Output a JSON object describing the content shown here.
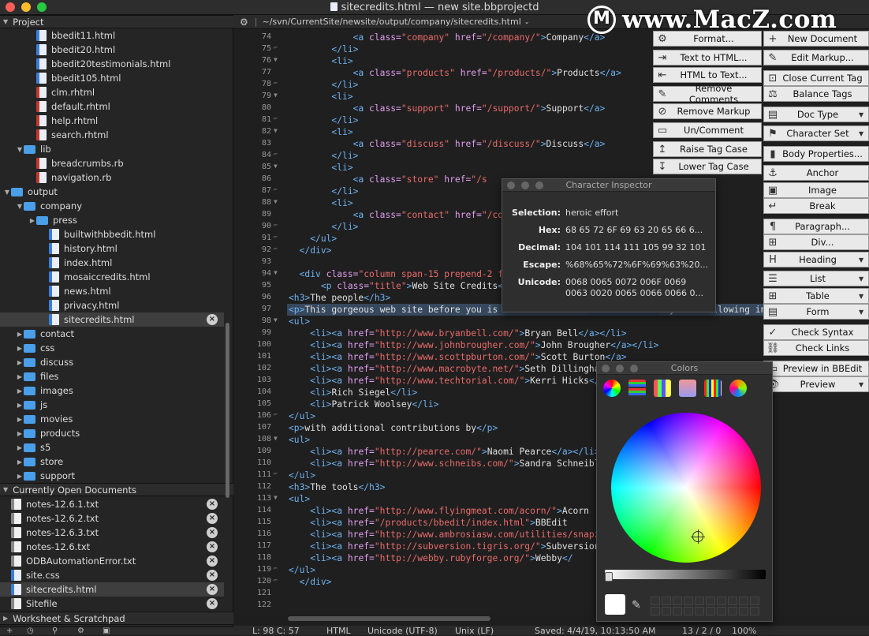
{
  "window": {
    "title": "sitecredits.html — new site.bbprojectd"
  },
  "watermark": {
    "text": "www.MacZ.com"
  },
  "sidebar": {
    "project_header": "Project",
    "tree": [
      {
        "label": "bbedit11.html",
        "type": "html",
        "indent": 2
      },
      {
        "label": "bbedit20.html",
        "type": "html",
        "indent": 2
      },
      {
        "label": "bbedit20testimonials.html",
        "type": "html",
        "indent": 2
      },
      {
        "label": "bbedit105.html",
        "type": "html",
        "indent": 2
      },
      {
        "label": "clm.rhtml",
        "type": "rhtml",
        "indent": 2
      },
      {
        "label": "default.rhtml",
        "type": "rhtml",
        "indent": 2
      },
      {
        "label": "help.rhtml",
        "type": "rhtml",
        "indent": 2
      },
      {
        "label": "search.rhtml",
        "type": "rhtml",
        "indent": 2
      },
      {
        "label": "lib",
        "type": "folder",
        "indent": 1,
        "disc": "▼"
      },
      {
        "label": "breadcrumbs.rb",
        "type": "rb",
        "indent": 2
      },
      {
        "label": "navigation.rb",
        "type": "rb",
        "indent": 2
      },
      {
        "label": "output",
        "type": "folder",
        "indent": 0,
        "disc": "▼"
      },
      {
        "label": "company",
        "type": "folder",
        "indent": 1,
        "disc": "▼"
      },
      {
        "label": "press",
        "type": "folder",
        "indent": 2,
        "disc": "▶"
      },
      {
        "label": "builtwithbbedit.html",
        "type": "html",
        "indent": 3
      },
      {
        "label": "history.html",
        "type": "html",
        "indent": 3
      },
      {
        "label": "index.html",
        "type": "html",
        "indent": 3
      },
      {
        "label": "mosaiccredits.html",
        "type": "html",
        "indent": 3
      },
      {
        "label": "news.html",
        "type": "html",
        "indent": 3
      },
      {
        "label": "privacy.html",
        "type": "html",
        "indent": 3
      },
      {
        "label": "sitecredits.html",
        "type": "html",
        "indent": 3,
        "selected": true,
        "close": true
      },
      {
        "label": "contact",
        "type": "folder",
        "indent": 1,
        "disc": "▶"
      },
      {
        "label": "css",
        "type": "folder",
        "indent": 1,
        "disc": "▶"
      },
      {
        "label": "discuss",
        "type": "folder",
        "indent": 1,
        "disc": "▶"
      },
      {
        "label": "files",
        "type": "folder",
        "indent": 1,
        "disc": "▶"
      },
      {
        "label": "images",
        "type": "folder",
        "indent": 1,
        "disc": "▶"
      },
      {
        "label": "js",
        "type": "folder",
        "indent": 1,
        "disc": "▶"
      },
      {
        "label": "movies",
        "type": "folder",
        "indent": 1,
        "disc": "▶"
      },
      {
        "label": "products",
        "type": "folder",
        "indent": 1,
        "disc": "▶"
      },
      {
        "label": "s5",
        "type": "folder",
        "indent": 1,
        "disc": "▶"
      },
      {
        "label": "store",
        "type": "folder",
        "indent": 1,
        "disc": "▶"
      },
      {
        "label": "support",
        "type": "folder",
        "indent": 1,
        "disc": "▶"
      }
    ],
    "open_docs_header": "Currently Open Documents",
    "open_docs": [
      {
        "label": "notes-12.6.1.txt",
        "type": "txt"
      },
      {
        "label": "notes-12.6.2.txt",
        "type": "txt"
      },
      {
        "label": "notes-12.6.3.txt",
        "type": "txt"
      },
      {
        "label": "notes-12.6.txt",
        "type": "txt"
      },
      {
        "label": "ODBAutomationError.txt",
        "type": "txt"
      },
      {
        "label": "site.css",
        "type": "css"
      },
      {
        "label": "sitecredits.html",
        "type": "html",
        "selected": true
      },
      {
        "label": "Sitefile",
        "type": "txt"
      }
    ],
    "worksheet_header": "Worksheet & Scratchpad"
  },
  "navbar": {
    "path": "~/svn/CurrentSite/newsite/output/company/sitecredits.html"
  },
  "editor": {
    "lines": [
      {
        "n": "74",
        "f": "",
        "h": "            <t>&lt;a</t> <a>class=</a><v>\"company\"</v> <a>href=</a><v>\"/company/\"</v><t>&gt;</t>Company<t>&lt;/a&gt;</t>"
      },
      {
        "n": "75",
        "f": "⌐",
        "h": "        <t>&lt;/li&gt;</t>"
      },
      {
        "n": "76",
        "f": "▼",
        "h": "        <t>&lt;li&gt;</t>"
      },
      {
        "n": "77",
        "f": "",
        "h": "            <t>&lt;a</t> <a>class=</a><v>\"products\"</v> <a>href=</a><v>\"/products/\"</v><t>&gt;</t>Products<t>&lt;/a&gt;</t>"
      },
      {
        "n": "78",
        "f": "⌐",
        "h": "        <t>&lt;/li&gt;</t>"
      },
      {
        "n": "79",
        "f": "▼",
        "h": "        <t>&lt;li&gt;</t>"
      },
      {
        "n": "80",
        "f": "",
        "h": "            <t>&lt;a</t> <a>class=</a><v>\"support\"</v> <a>href=</a><v>\"/support/\"</v><t>&gt;</t>Support<t>&lt;/a&gt;</t>"
      },
      {
        "n": "81",
        "f": "⌐",
        "h": "        <t>&lt;/li&gt;</t>"
      },
      {
        "n": "82",
        "f": "▼",
        "h": "        <t>&lt;li&gt;</t>"
      },
      {
        "n": "83",
        "f": "",
        "h": "            <t>&lt;a</t> <a>class=</a><v>\"discuss\"</v> <a>href=</a><v>\"/discuss/\"</v><t>&gt;</t>Discuss<t>&lt;/a&gt;</t>"
      },
      {
        "n": "84",
        "f": "⌐",
        "h": "        <t>&lt;/li&gt;</t>"
      },
      {
        "n": "85",
        "f": "▼",
        "h": "        <t>&lt;li&gt;</t>"
      },
      {
        "n": "86",
        "f": "",
        "h": "            <t>&lt;a</t> <a>class=</a><v>\"store\"</v> <a>href=</a><v>\"/s</v>"
      },
      {
        "n": "87",
        "f": "⌐",
        "h": "        <t>&lt;/li&gt;</t>"
      },
      {
        "n": "88",
        "f": "▼",
        "h": "        <t>&lt;li&gt;</t>"
      },
      {
        "n": "89",
        "f": "",
        "h": "            <t>&lt;a</t> <a>class=</a><v>\"contact\"</v> <a>href=</a><v>\"/contact/\"</v><t>&gt;</t>Contact<t>&lt;/a&gt;</t>"
      },
      {
        "n": "90",
        "f": "⌐",
        "h": "        <t>&lt;/li&gt;</t>"
      },
      {
        "n": "91",
        "f": "⌐",
        "h": "    <t>&lt;/ul&gt;</t>"
      },
      {
        "n": "92",
        "f": "⌐",
        "h": "  <t>&lt;/div&gt;</t>"
      },
      {
        "n": "93",
        "f": "",
        "h": ""
      },
      {
        "n": "94",
        "f": "▼",
        "h": "  <t>&lt;div</t> <a>class=</a><v>\"column span-15 prepend-2 f</v>"
      },
      {
        "n": "95",
        "f": "",
        "h": "      <t>&lt;p</t> <a>class=</a><v>\"title\"</v><t>&gt;</t>Web Site Credits<t>&lt;/</t>"
      },
      {
        "n": "96",
        "f": "",
        "h": "<t>&lt;h3&gt;</t>The people<t>&lt;/h3&gt;</t>"
      },
      {
        "n": "97",
        "f": "",
        "h": "<t>&lt;p&gt;</t>This gorgeous web site before you is the result of a <span class=\"hl\">heroic effort</span> by the following indiv",
        "sel": true
      },
      {
        "n": "98",
        "f": "▼",
        "h": "<t>&lt;ul&gt;</t>"
      },
      {
        "n": "99",
        "f": "",
        "h": "    <t>&lt;li&gt;&lt;a</t> <a>href=</a><v>\"http://www.bryanbell.com/\"</v><t>&gt;</t>Bryan Bell<t>&lt;/a&gt;&lt;/li&gt;</t>"
      },
      {
        "n": "100",
        "f": "",
        "h": "    <t>&lt;li&gt;&lt;a</t> <a>href=</a><v>\"http://www.johnbrougher.com/\"</v><t>&gt;</t>John Brougher<t>&lt;/a&gt;&lt;/li&gt;</t>"
      },
      {
        "n": "101",
        "f": "",
        "h": "    <t>&lt;li&gt;&lt;a</t> <a>href=</a><v>\"http://www.scottpburton.com/\"</v><t>&gt;</t>Scott Burton<t>&lt;/a&gt;</t>"
      },
      {
        "n": "102",
        "f": "",
        "h": "    <t>&lt;li&gt;&lt;a</t> <a>href=</a><v>\"http://www.macrobyte.net/\"</v><t>&gt;</t>Seth Dillingham"
      },
      {
        "n": "103",
        "f": "",
        "h": "    <t>&lt;li&gt;&lt;a</t> <a>href=</a><v>\"http://www.techtorial.com/\"</v><t>&gt;</t>Kerri Hicks<t>&lt;/a&gt;</t>"
      },
      {
        "n": "104",
        "f": "",
        "h": "    <t>&lt;li&gt;</t>Rich Siegel<t>&lt;/li&gt;</t>"
      },
      {
        "n": "105",
        "f": "",
        "h": "    <t>&lt;li&gt;</t>Patrick Woolsey<t>&lt;/li&gt;</t>"
      },
      {
        "n": "106",
        "f": "⌐",
        "h": "<t>&lt;/ul&gt;</t>"
      },
      {
        "n": "107",
        "f": "",
        "h": "<t>&lt;p&gt;</t>with additional contributions by<t>&lt;/p&gt;</t>"
      },
      {
        "n": "108",
        "f": "▼",
        "h": "<t>&lt;ul&gt;</t>"
      },
      {
        "n": "109",
        "f": "",
        "h": "    <t>&lt;li&gt;&lt;a</t> <a>href=</a><v>\"http://pearce.com/\"</v><t>&gt;</t>Naomi Pearce<t>&lt;/a&gt;&lt;/li&gt;</t>"
      },
      {
        "n": "110",
        "f": "",
        "h": "    <t>&lt;li&gt;&lt;a</t> <a>href=</a><v>\"http://www.schneibs.com/\"</v><t>&gt;</t>Sandra Schneible"
      },
      {
        "n": "111",
        "f": "⌐",
        "h": "<t>&lt;/ul&gt;</t>"
      },
      {
        "n": "112",
        "f": "",
        "h": "<t>&lt;h3&gt;</t>The tools<t>&lt;/h3&gt;</t>"
      },
      {
        "n": "113",
        "f": "▼",
        "h": "<t>&lt;ul&gt;</t>"
      },
      {
        "n": "114",
        "f": "",
        "h": "    <t>&lt;li&gt;&lt;a</t> <a>href=</a><v>\"http://www.flyingmeat.com/acorn/\"</v><t>&gt;</t>Acorn"
      },
      {
        "n": "115",
        "f": "",
        "h": "    <t>&lt;li&gt;&lt;a</t> <a>href=</a><v>\"/products/bbedit/index.html\"</v><t>&gt;</t>BBEdit"
      },
      {
        "n": "116",
        "f": "",
        "h": "    <t>&lt;li&gt;&lt;a</t> <a>href=</a><v>\"http://www.ambrosiasw.com/utilities/snapzpr</v>"
      },
      {
        "n": "117",
        "f": "",
        "h": "    <t>&lt;li&gt;&lt;a</t> <a>href=</a><v>\"http://subversion.tigris.org/\"</v><t>&gt;</t>Subversion"
      },
      {
        "n": "118",
        "f": "",
        "h": "    <t>&lt;li&gt;&lt;a</t> <a>href=</a><v>\"http://webby.rubyforge.org/\"</v><t>&gt;</t>Webby<t>&lt;/</t>"
      },
      {
        "n": "119",
        "f": "⌐",
        "h": "<t>&lt;/ul&gt;</t>"
      },
      {
        "n": "120",
        "f": "⌐",
        "h": "  <t>&lt;/div&gt;</t>"
      },
      {
        "n": "121",
        "f": "",
        "h": ""
      },
      {
        "n": "122",
        "f": "",
        "h": ""
      }
    ]
  },
  "statusbar": {
    "position": "L: 98 C: 57",
    "language": "HTML",
    "encoding": "Unicode (UTF-8)",
    "line_endings": "Unix (LF)",
    "saved": "Saved: 4/4/19, 10:13:50 AM",
    "counts": "13 / 2 / 0",
    "zoom": "100%"
  },
  "bottombar": {
    "worksheet": "Worksheet & Scratchpad"
  },
  "palette": {
    "left": [
      {
        "label": "Format...",
        "icon": "⚙"
      },
      {
        "label": "Text to HTML...",
        "icon": "⇥"
      },
      {
        "label": "HTML to Text...",
        "icon": "⇤"
      },
      {
        "label": "Remove Comments",
        "icon": "✎"
      },
      {
        "label": "Remove Markup",
        "icon": "⊘"
      },
      {
        "label": "Un/Comment",
        "icon": "▭"
      },
      {
        "label": "Raise Tag Case",
        "icon": "↥"
      },
      {
        "label": "Lower Tag Case",
        "icon": "↧"
      }
    ],
    "right": [
      {
        "label": "New Document",
        "icon": "+"
      },
      {
        "label": "Edit Markup...",
        "icon": "✎"
      },
      {
        "label": "Close Current Tag",
        "icon": "⊡"
      },
      {
        "label": "Balance Tags",
        "icon": "⚖"
      },
      {
        "label": "Doc Type",
        "icon": "▤",
        "arrow": true
      },
      {
        "label": "Character Set",
        "icon": "⚑",
        "arrow": true
      },
      {
        "label": "Body Properties...",
        "icon": "▮"
      },
      {
        "label": "Anchor",
        "icon": "⚓"
      },
      {
        "label": "Image",
        "icon": "▣"
      },
      {
        "label": "Break",
        "icon": "↵"
      },
      {
        "label": "Paragraph...",
        "icon": "¶"
      },
      {
        "label": "Div...",
        "icon": "⊞"
      },
      {
        "label": "Heading",
        "icon": "H",
        "arrow": true
      },
      {
        "label": "List",
        "icon": "☰",
        "arrow": true
      },
      {
        "label": "Table",
        "icon": "⊞",
        "arrow": true
      },
      {
        "label": "Form",
        "icon": "▤",
        "arrow": true
      },
      {
        "label": "Check Syntax",
        "icon": "✓"
      },
      {
        "label": "Check Links",
        "icon": "⛓"
      },
      {
        "label": "Preview in BBEdit",
        "icon": "▭"
      },
      {
        "label": "Preview",
        "icon": "👁",
        "arrow": true
      }
    ]
  },
  "char_inspector": {
    "title": "Character Inspector",
    "rows": [
      {
        "k": "Selection:",
        "v": "heroic effort"
      },
      {
        "k": "Hex:",
        "v": "68 65 72 6F 69 63 20 65 66 6..."
      },
      {
        "k": "Decimal:",
        "v": "104 101 114 111 105 99 32 101 1..."
      },
      {
        "k": "Escape:",
        "v": "%68%65%72%6F%69%63%20..."
      },
      {
        "k": "Unicode:",
        "v": "0068 0065 0072 006F 0069"
      },
      {
        "k": "",
        "v": "0063 0020 0065 0066 0066 0..."
      }
    ]
  },
  "colors_panel": {
    "title": "Colors"
  },
  "colors": {
    "accent": "#3b7dd8",
    "selection": "#36485d"
  }
}
